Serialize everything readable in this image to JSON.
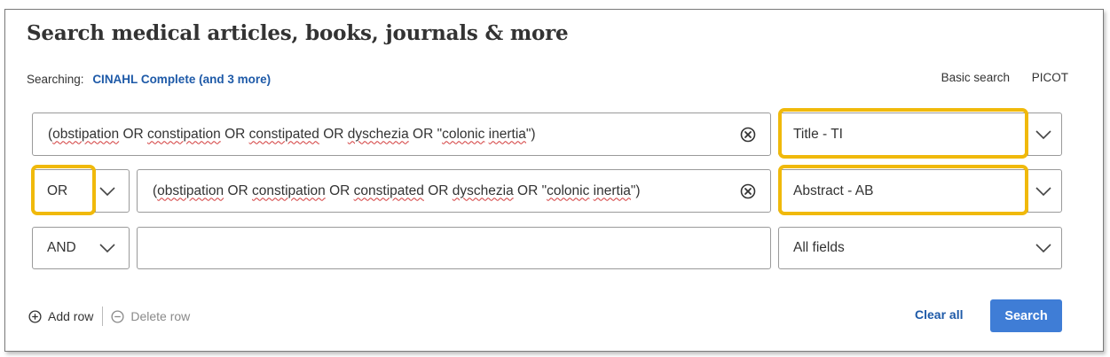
{
  "header": {
    "title": "Search medical articles, books, journals & more"
  },
  "searching": {
    "label": "Searching:",
    "databases_link": "CINAHL Complete (and 3 more)"
  },
  "mode_links": {
    "basic_search": "Basic search",
    "picot": "PICOT"
  },
  "rows": [
    {
      "operator": "",
      "query_parts": [
        "(",
        "obstipation",
        " OR ",
        "constipation",
        " OR ",
        "constipated",
        " OR ",
        "dyschezia",
        " OR \"",
        "colonic",
        " ",
        "inertia",
        "\")"
      ],
      "field": "Title - TI"
    },
    {
      "operator": "OR",
      "query_parts": [
        "(",
        "obstipation",
        " OR ",
        "constipation",
        " OR ",
        "constipated",
        " OR ",
        "dyschezia",
        " OR \"",
        "colonic",
        " ",
        "inertia",
        "\")"
      ],
      "field": "Abstract - AB"
    },
    {
      "operator": "AND",
      "query_parts": [],
      "field": "All fields"
    }
  ],
  "actions": {
    "add_row": "Add row",
    "delete_row": "Delete row",
    "clear_all": "Clear all",
    "search": "Search"
  },
  "icons": {
    "clear": "clear-circle-x-icon",
    "dropdown": "chevron-down-icon",
    "add": "plus-circle-icon",
    "delete": "minus-circle-icon"
  },
  "colors": {
    "link": "#1e5aa8",
    "primary_button": "#3f7dd6",
    "highlight": "#f0b90b",
    "spellcheck": "#d23a3a"
  }
}
